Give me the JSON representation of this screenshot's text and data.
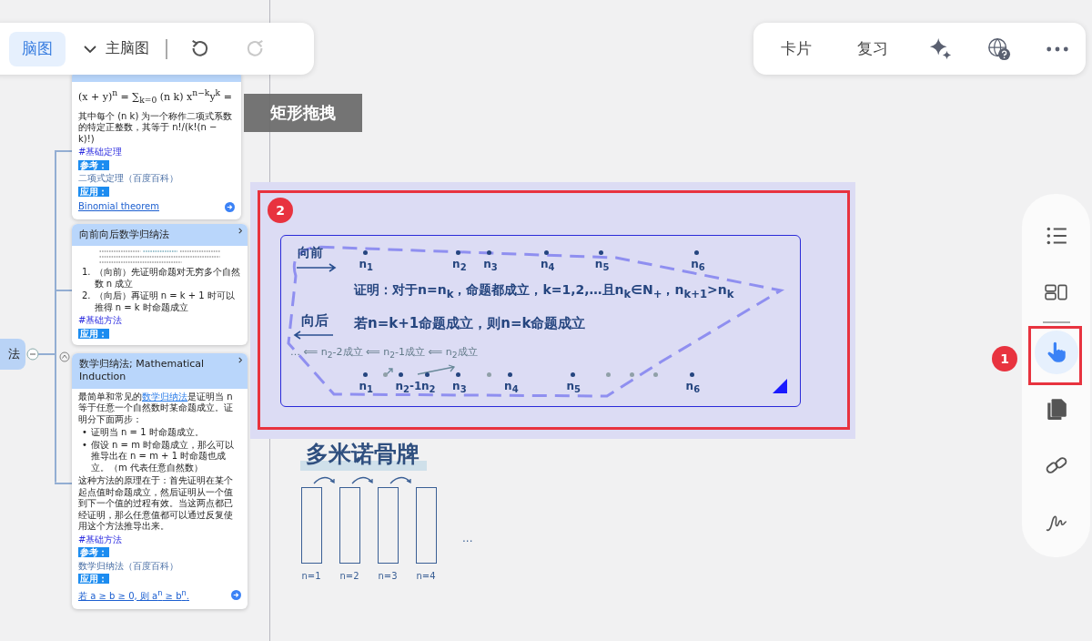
{
  "toolbar_left": {
    "tabs": [
      {
        "label": "脑图",
        "selected": true
      }
    ],
    "map_selector": "主脑图",
    "undo": {
      "disabled": false
    },
    "redo": {
      "disabled": true
    }
  },
  "toolbar_right": {
    "items": [
      "卡片",
      "复习"
    ]
  },
  "tooltip": "矩形拖拽",
  "root_node": "法",
  "cards": [
    {
      "blocks": [
        {
          "kind": "formula",
          "text": "(x + y)$^{n}$ = ∑$_{k=0}$ (n k) x$^{n−k}$y$^{k}$ ="
        },
        {
          "kind": "text",
          "text": "其中每个 (n k) 为一个称作二项式系数的特定正整数，其等于 n!/(k!(n − k)!)"
        },
        {
          "kind": "tag",
          "text": "#基础定理"
        },
        {
          "kind": "label",
          "text": "参考："
        },
        {
          "kind": "ref",
          "text": "二项式定理（百度百科）"
        },
        {
          "kind": "label",
          "text": "应用："
        },
        {
          "kind": "link",
          "text": "Binomial theorem"
        }
      ]
    },
    {
      "title": "向前向后数学归纳法",
      "blocks": [
        {
          "kind": "faint_note"
        },
        {
          "kind": "list",
          "items": [
            {
              "marker": "1.",
              "text": "（向前）先证明命题对无穷多个自然数 n 成立"
            },
            {
              "marker": "2.",
              "text": "（向后）再证明 n = k + 1 时可以推得 n = k 时命题成立"
            }
          ]
        },
        {
          "kind": "tag",
          "text": "#基础方法"
        },
        {
          "kind": "label",
          "text": "应用："
        }
      ]
    },
    {
      "title": "数学归纳法; Mathematical Induction",
      "blocks": [
        {
          "kind": "text_link",
          "before": "最简单和常见的",
          "link": "数学归纳法",
          "after": "是证明当 n 等于任意一个自然数时某命题成立。证明分下面两步："
        },
        {
          "kind": "list",
          "items": [
            {
              "marker": "•",
              "text": "证明当 n = 1 时命题成立。"
            },
            {
              "marker": "•",
              "text": "假设 n = m 时命题成立，那么可以推导出在 n = m + 1 时命题也成立。（m 代表任意自然数）"
            }
          ]
        },
        {
          "kind": "text",
          "text": "这种方法的原理在于：首先证明在某个起点值时命题成立，然后证明从一个值到下一个值的过程有效。当这两点都已经证明，那么任意值都可以通过反复使用这个方法推导出来。"
        },
        {
          "kind": "tag",
          "text": "#基础方法"
        },
        {
          "kind": "label",
          "text": "参考："
        },
        {
          "kind": "ref",
          "text": "数学归纳法（百度百科）"
        },
        {
          "kind": "label",
          "text": "应用："
        },
        {
          "kind": "link",
          "text": "若 a ≥ b ≥ 0, 则 a$^{n}$ ≥ b$^{n}$."
        }
      ]
    }
  ],
  "note_image": {
    "forward": "向前",
    "top_points": [
      "n$_{1}$",
      "n$_{2}$",
      "n$_{3}$",
      "n$_{4}$",
      "n$_{5}$",
      "n$_{6}$"
    ],
    "proof": "证明：对于n=n$_{k}$，命题都成立，k=1,2,…且n$_{k}$∈N$_{+}$，n$_{k+1}$>n$_{k}$",
    "backward": "向后",
    "backward_rule": "若n=k+1命题成立，则n=k命题成立",
    "chain": "… ⟸ n$_{2}$-2成立 ⟸ n$_{2}$-1成立 ⟸ n$_{2}$成立",
    "bottom_points": [
      "n$_{1}$",
      "n$_{2}$-1",
      "n$_{2}$",
      "n$_{3}$",
      "n$_{4}$",
      "n$_{5}$",
      "n$_{6}$"
    ]
  },
  "domino": {
    "title": "多米诺骨牌",
    "labels": [
      "n=1",
      "n=2",
      "n=3",
      "n=4"
    ],
    "ellipsis": "..."
  },
  "side_toolbar": {
    "tools": [
      {
        "kind": "list",
        "selected": false
      },
      {
        "kind": "layout",
        "selected": false
      },
      {
        "kind": "hand",
        "selected": true
      },
      {
        "kind": "copy",
        "selected": false
      },
      {
        "kind": "link",
        "selected": false
      },
      {
        "kind": "draw",
        "selected": false
      }
    ]
  },
  "markers": [
    "1",
    "2"
  ]
}
